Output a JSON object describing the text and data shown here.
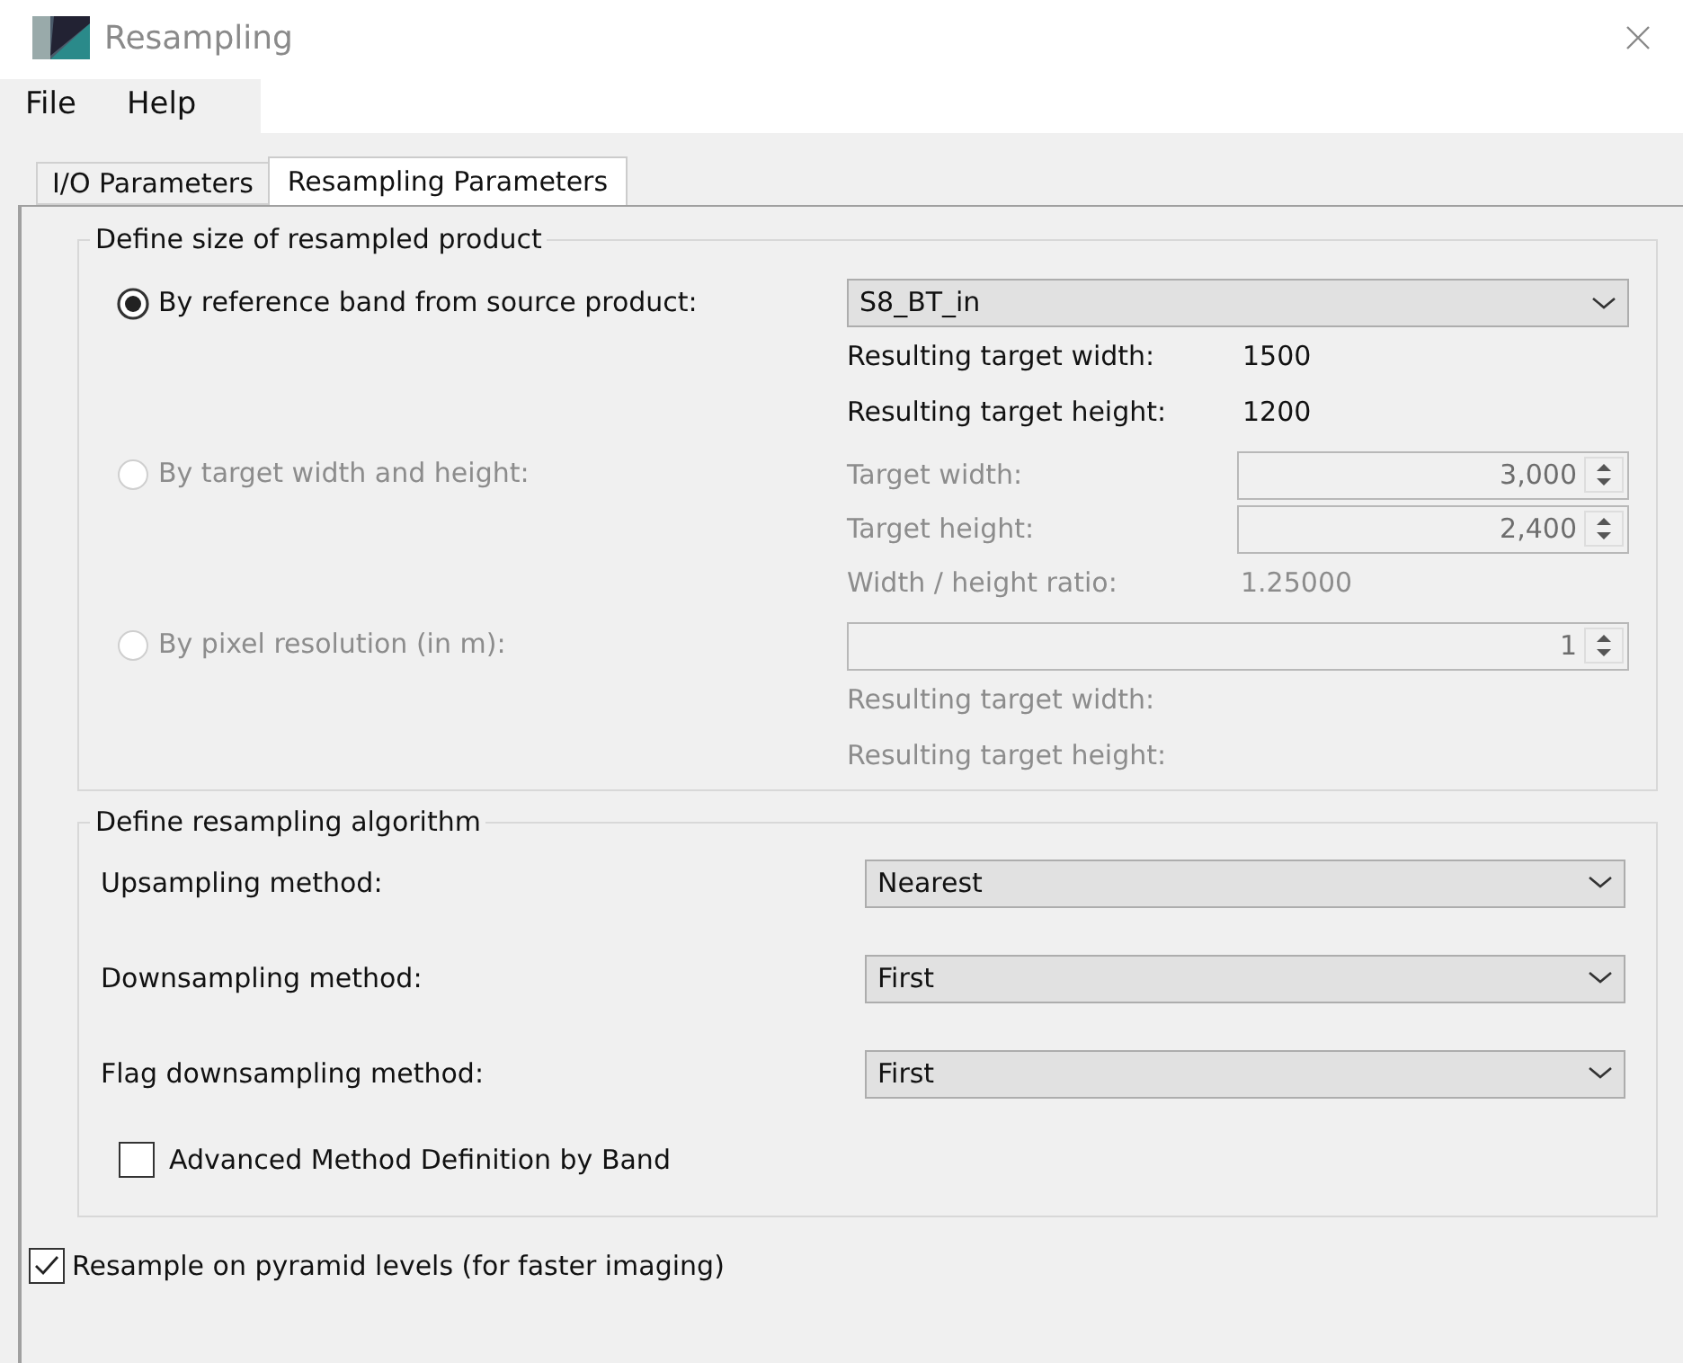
{
  "window": {
    "title": "Resampling"
  },
  "menu": [
    {
      "label": "File"
    },
    {
      "label": "Help"
    }
  ],
  "tabs": [
    {
      "label": "I/O Parameters",
      "selected": false
    },
    {
      "label": "Resampling Parameters",
      "selected": true
    }
  ],
  "size_group": {
    "title": "Define size of resampled product",
    "options": [
      {
        "kind": "reference",
        "label": "By reference band from source product:",
        "selected": true,
        "disabled": false,
        "dropdown": {
          "value": "S8_BT_in"
        },
        "rows": [
          {
            "label": "Resulting target width:",
            "value": "1500"
          },
          {
            "label": "Resulting target height:",
            "value": "1200"
          }
        ]
      },
      {
        "kind": "dimensions",
        "label": "By target width and height:",
        "selected": false,
        "disabled": true,
        "fields": [
          {
            "label": "Target width:",
            "value": "3,000"
          },
          {
            "label": "Target height:",
            "value": "2,400"
          }
        ],
        "ratio": {
          "label": "Width / height ratio:",
          "value": "1.25000"
        }
      },
      {
        "kind": "resolution",
        "label": "By pixel resolution (in m):",
        "selected": false,
        "disabled": true,
        "spinner": {
          "value": "1"
        },
        "rows": [
          {
            "label": "Resulting target width:"
          },
          {
            "label": "Resulting target height:"
          }
        ]
      }
    ]
  },
  "algorithm_group": {
    "title": "Define resampling algorithm",
    "methods": [
      {
        "label": "Upsampling method:",
        "value": "Nearest"
      },
      {
        "label": "Downsampling method:",
        "value": "First"
      },
      {
        "label": "Flag downsampling method:",
        "value": "First"
      }
    ],
    "advanced": {
      "label": "Advanced Method Definition by Band",
      "checked": false
    }
  },
  "pyramid": {
    "label": "Resample on pyramid levels (for faster imaging)",
    "checked": true
  }
}
